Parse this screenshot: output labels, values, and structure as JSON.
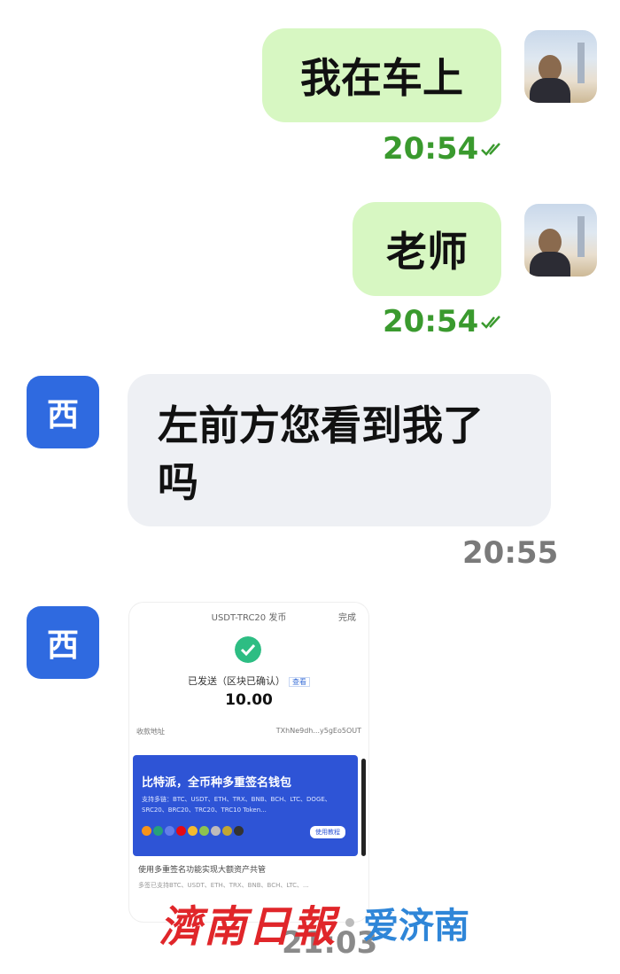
{
  "messages": [
    {
      "text": "我在车上",
      "time": "20:54"
    },
    {
      "text": "老师",
      "time": "20:54"
    },
    {
      "text": "左前方您看到我了吗",
      "time": "20:55",
      "avatar": "西"
    },
    {
      "time": "21:03",
      "avatar": "西"
    }
  ],
  "screenshot": {
    "title": "USDT-TRC20 发币",
    "done": "完成",
    "status": "已发送（区块已确认）",
    "tag": "查看",
    "amount": "10.00",
    "row_label": "收款地址",
    "row_value": "TXhNe9dh...y5gEo5OUT",
    "banner_title": "比特派，全币种多重签名钱包",
    "banner_sub": "支持多链：BTC、USDT、ETH、TRX、BNB、BCH、LTC、DOGE、SRC20、BRC20、TRC20、TRC10 Token...",
    "banner_button": "使用教程",
    "desc": "使用多重签名功能实现大额资产共管",
    "desc2": "多签已支持BTC、USDT、ETH、TRX、BNB、BCH、LTC、..."
  },
  "watermark": {
    "left": "濟南日報",
    "right": "爱济南"
  },
  "colors": {
    "out_bubble": "#d7f7c2",
    "in_bubble": "#eef0f4",
    "time_green": "#3a9a2e",
    "avatar_blue": "#2f6ae0"
  },
  "icons": {
    "check": "double-check-icon"
  }
}
